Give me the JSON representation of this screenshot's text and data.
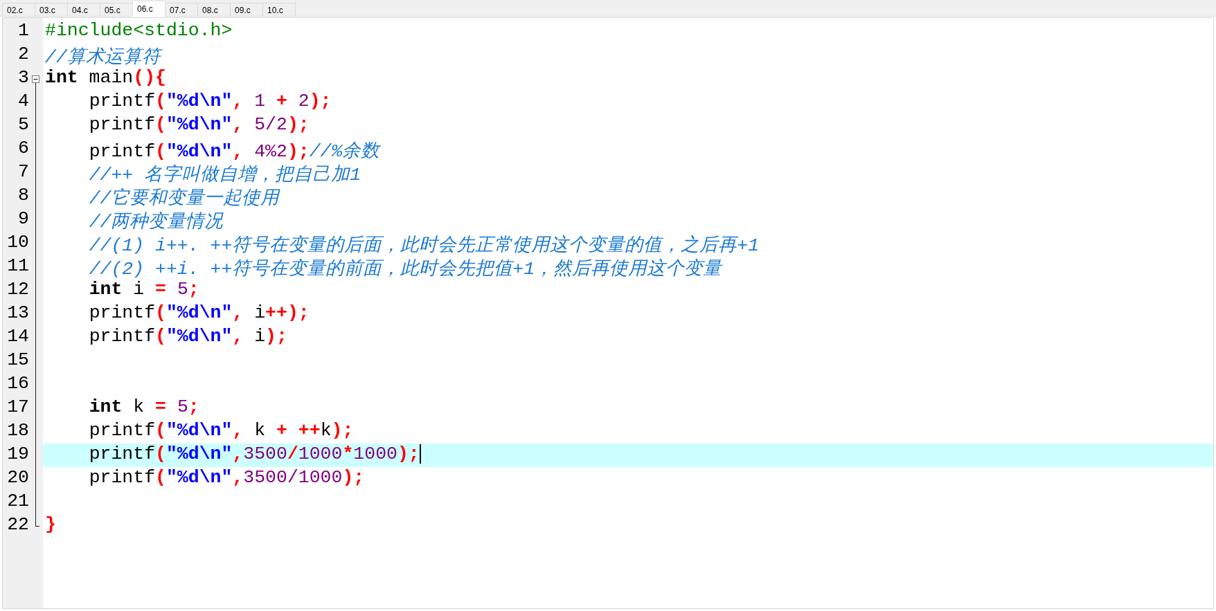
{
  "tabs": [
    {
      "label": "02.c",
      "selected": false
    },
    {
      "label": "03.c",
      "selected": false
    },
    {
      "label": "04.c",
      "selected": false
    },
    {
      "label": "05.c",
      "selected": false
    },
    {
      "label": "06.c",
      "selected": true
    },
    {
      "label": "07.c",
      "selected": false
    },
    {
      "label": "08.c",
      "selected": false
    },
    {
      "label": "09.c",
      "selected": false
    },
    {
      "label": "10.c",
      "selected": false
    }
  ],
  "editor": {
    "lines": [
      {
        "number": "1",
        "current": false,
        "tokens": [
          {
            "text": "#include<stdio.h>",
            "kind": "preprocessor"
          }
        ]
      },
      {
        "number": "2",
        "current": false,
        "tokens": [
          {
            "text": "//算术运算符",
            "kind": "comment"
          }
        ]
      },
      {
        "number": "3",
        "current": false,
        "expanded": true,
        "tokens": [
          {
            "text": "int",
            "kind": "keyword"
          },
          {
            "text": " main",
            "kind": "plain"
          },
          {
            "text": "(){",
            "kind": "symbol"
          }
        ],
        "children": [
          {
            "number": "4",
            "current": false,
            "tokens": [
              {
                "text": "    printf",
                "kind": "plain"
              },
              {
                "text": "(",
                "kind": "symbol"
              },
              {
                "text": "\"%d\\n\"",
                "kind": "string"
              },
              {
                "text": ", ",
                "kind": "symbol"
              },
              {
                "text": "1",
                "kind": "number"
              },
              {
                "text": " + ",
                "kind": "symbol"
              },
              {
                "text": "2",
                "kind": "number"
              },
              {
                "text": ");",
                "kind": "symbol"
              }
            ]
          },
          {
            "number": "5",
            "current": false,
            "tokens": [
              {
                "text": "    printf",
                "kind": "plain"
              },
              {
                "text": "(",
                "kind": "symbol"
              },
              {
                "text": "\"%d\\n\"",
                "kind": "string"
              },
              {
                "text": ", ",
                "kind": "symbol"
              },
              {
                "text": "5/2",
                "kind": "number"
              },
              {
                "text": ");",
                "kind": "symbol"
              }
            ]
          },
          {
            "number": "6",
            "current": false,
            "tokens": [
              {
                "text": "    printf",
                "kind": "plain"
              },
              {
                "text": "(",
                "kind": "symbol"
              },
              {
                "text": "\"%d\\n\"",
                "kind": "string"
              },
              {
                "text": ", ",
                "kind": "symbol"
              },
              {
                "text": "4%2",
                "kind": "number"
              },
              {
                "text": ");",
                "kind": "symbol"
              },
              {
                "text": "//%余数",
                "kind": "comment"
              }
            ]
          },
          {
            "number": "7",
            "current": false,
            "tokens": [
              {
                "text": "    //++ 名字叫做自增，把自己加1",
                "kind": "comment"
              }
            ]
          },
          {
            "number": "8",
            "current": false,
            "tokens": [
              {
                "text": "    //它要和变量一起使用",
                "kind": "comment"
              }
            ]
          },
          {
            "number": "9",
            "current": false,
            "tokens": [
              {
                "text": "    //两种变量情况",
                "kind": "comment"
              }
            ]
          },
          {
            "number": "10",
            "current": false,
            "tokens": [
              {
                "text": "    //(1) i++. ++符号在变量的后面，此时会先正常使用这个变量的值，之后再+1",
                "kind": "comment"
              }
            ]
          },
          {
            "number": "11",
            "current": false,
            "tokens": [
              {
                "text": "    //(2) ++i. ++符号在变量的前面，此时会先把值+1，然后再使用这个变量",
                "kind": "comment"
              }
            ]
          },
          {
            "number": "12",
            "current": false,
            "tokens": [
              {
                "text": "    int",
                "kind": "keyword"
              },
              {
                "text": " i ",
                "kind": "plain"
              },
              {
                "text": "= ",
                "kind": "symbol"
              },
              {
                "text": "5",
                "kind": "number"
              },
              {
                "text": ";",
                "kind": "symbol"
              }
            ]
          },
          {
            "number": "13",
            "current": false,
            "tokens": [
              {
                "text": "    printf",
                "kind": "plain"
              },
              {
                "text": "(",
                "kind": "symbol"
              },
              {
                "text": "\"%d\\n\"",
                "kind": "string"
              },
              {
                "text": ", ",
                "kind": "symbol"
              },
              {
                "text": "i",
                "kind": "plain"
              },
              {
                "text": "++);",
                "kind": "symbol"
              }
            ]
          },
          {
            "number": "14",
            "current": false,
            "tokens": [
              {
                "text": "    printf",
                "kind": "plain"
              },
              {
                "text": "(",
                "kind": "symbol"
              },
              {
                "text": "\"%d\\n\"",
                "kind": "string"
              },
              {
                "text": ", ",
                "kind": "symbol"
              },
              {
                "text": "i",
                "kind": "plain"
              },
              {
                "text": ");",
                "kind": "symbol"
              }
            ]
          },
          {
            "number": "15",
            "current": false
          },
          {
            "number": "16",
            "current": false
          },
          {
            "number": "17",
            "current": false,
            "tokens": [
              {
                "text": "    int",
                "kind": "keyword"
              },
              {
                "text": " k ",
                "kind": "plain"
              },
              {
                "text": "= ",
                "kind": "symbol"
              },
              {
                "text": "5",
                "kind": "number"
              },
              {
                "text": ";",
                "kind": "symbol"
              }
            ]
          },
          {
            "number": "18",
            "current": false,
            "tokens": [
              {
                "text": "    printf",
                "kind": "plain"
              },
              {
                "text": "(",
                "kind": "symbol"
              },
              {
                "text": "\"%d\\n\"",
                "kind": "string"
              },
              {
                "text": ", ",
                "kind": "symbol"
              },
              {
                "text": "k ",
                "kind": "plain"
              },
              {
                "text": "+ ++",
                "kind": "symbol"
              },
              {
                "text": "k",
                "kind": "plain"
              },
              {
                "text": ");",
                "kind": "symbol"
              }
            ]
          },
          {
            "number": "19",
            "current": true,
            "tokens": [
              {
                "text": "    printf",
                "kind": "plain"
              },
              {
                "text": "(",
                "kind": "symbol"
              },
              {
                "text": "\"%d\\n\"",
                "kind": "string"
              },
              {
                "text": ",",
                "kind": "symbol"
              },
              {
                "text": "3500",
                "kind": "number"
              },
              {
                "text": "/",
                "kind": "symbol"
              },
              {
                "text": "1000",
                "kind": "number"
              },
              {
                "text": "*",
                "kind": "symbol"
              },
              {
                "text": "1000",
                "kind": "number"
              },
              {
                "text": ");",
                "kind": "symbol"
              }
            ]
          },
          {
            "number": "20",
            "current": false,
            "tokens": [
              {
                "text": "    printf",
                "kind": "plain"
              },
              {
                "text": "(",
                "kind": "symbol"
              },
              {
                "text": "\"%d\\n\"",
                "kind": "string"
              },
              {
                "text": ",",
                "kind": "symbol"
              },
              {
                "text": "3500/1000",
                "kind": "number"
              },
              {
                "text": ");",
                "kind": "symbol"
              }
            ]
          },
          {
            "number": "21",
            "current": false
          },
          {
            "number": "22",
            "current": false,
            "tokens": [
              {
                "text": "}",
                "kind": "symbol"
              }
            ]
          }
        ]
      }
    ]
  }
}
